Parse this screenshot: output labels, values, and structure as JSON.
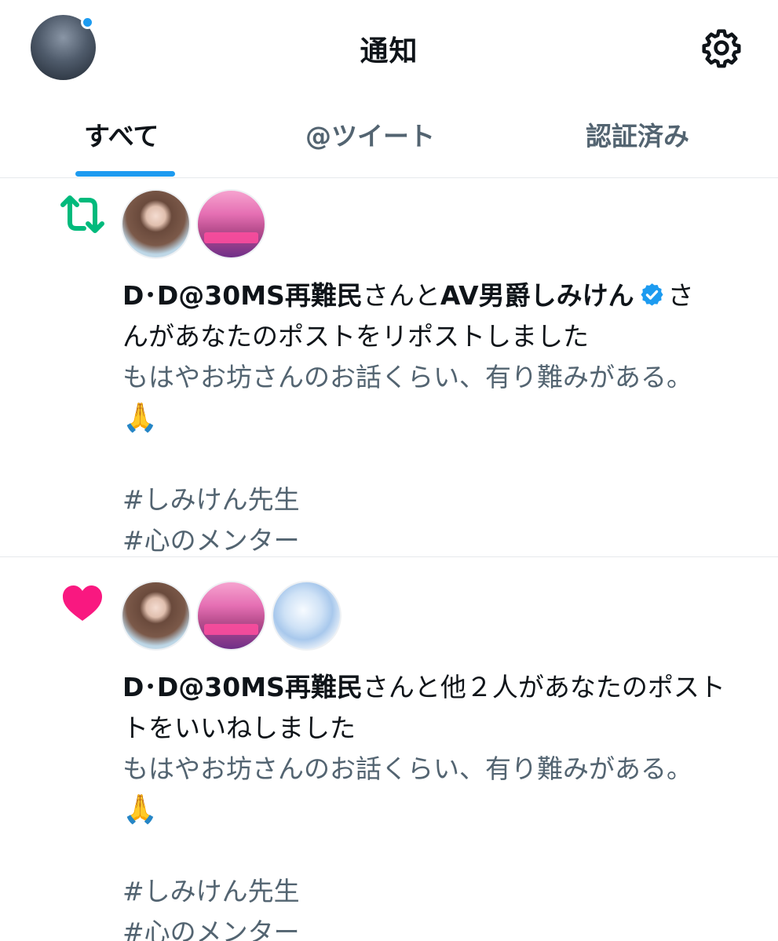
{
  "header": {
    "title": "通知",
    "avatar_icon": "profile-avatar",
    "settings_icon": "gear-icon",
    "unread_dot_color": "#1d9bf0"
  },
  "tabs": [
    {
      "label": "すべて",
      "active": true
    },
    {
      "label": "@ツイート",
      "active": false
    },
    {
      "label": "認証済み",
      "active": false
    }
  ],
  "notifications": [
    {
      "type": "repost",
      "type_icon": "repost-icon",
      "type_color": "#00ba7c",
      "actor_1": "D･D@30MS再難民",
      "connector": "さんと",
      "actor_2": "AV男爵しみけん",
      "verified_icon": "verified-badge-icon",
      "action_text_1": "さ",
      "action_text_2": "んがあなたのポストをリポストしました",
      "preview_line_1": "もはやお坊さんのお話くらい、有り難みがある。",
      "preview_emoji": "🙏",
      "preview_tag_1": "#しみけん先生",
      "preview_tag_2": "#心のメンター"
    },
    {
      "type": "like",
      "type_icon": "heart-icon",
      "type_color": "#f91880",
      "actor_1": "D･D@30MS再難民",
      "action_text_1": "さんと他２人があなたのポスト",
      "action_text_2": "をいいねしました",
      "action_text_2_prefix": "ト",
      "preview_line_1": "もはやお坊さんのお話くらい、有り難みがある。",
      "preview_emoji": "🙏",
      "preview_tag_1": "#しみけん先生",
      "preview_tag_2": "#心のメンター"
    }
  ]
}
